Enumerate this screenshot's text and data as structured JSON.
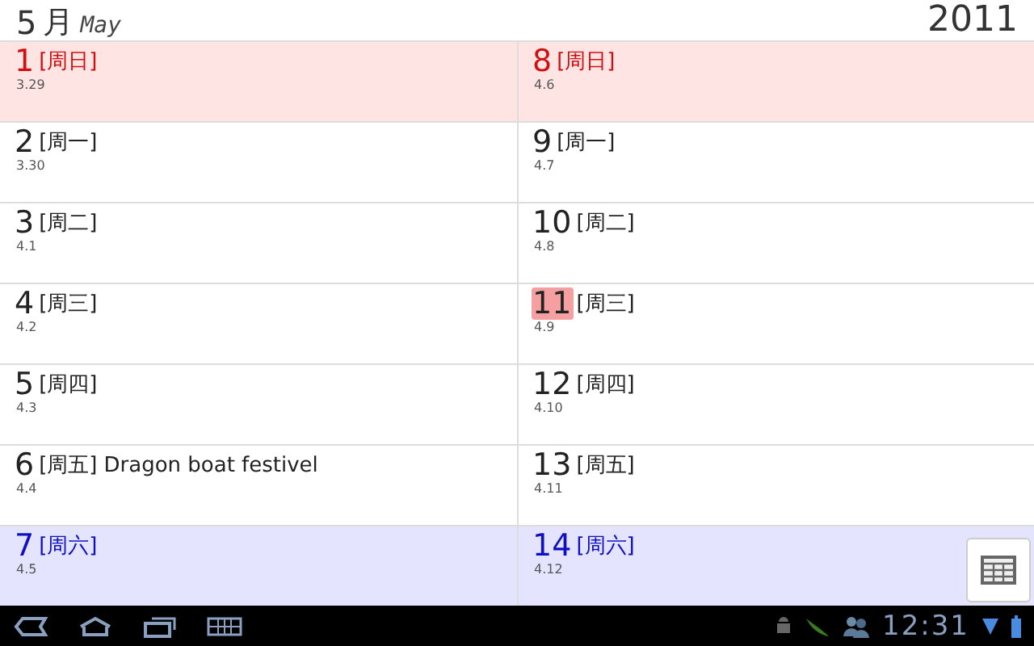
{
  "header": {
    "month_number": "5",
    "month_cn": "月",
    "month_en": "May",
    "year": "2011"
  },
  "columns": [
    {
      "days": [
        {
          "day": "1",
          "weekday": "[周日]",
          "lunar": "3.29",
          "kind": "sunday",
          "selected": false
        },
        {
          "day": "2",
          "weekday": "[周一]",
          "lunar": "3.30",
          "kind": "weekday",
          "selected": false
        },
        {
          "day": "3",
          "weekday": "[周二]",
          "lunar": "4.1",
          "kind": "weekday",
          "selected": false
        },
        {
          "day": "4",
          "weekday": "[周三]",
          "lunar": "4.2",
          "kind": "weekday",
          "selected": false
        },
        {
          "day": "5",
          "weekday": "[周四]",
          "lunar": "4.3",
          "kind": "weekday",
          "selected": false
        },
        {
          "day": "6",
          "weekday": "[周五]",
          "lunar": "4.4",
          "kind": "weekday",
          "selected": false,
          "event": "Dragon boat festivel"
        },
        {
          "day": "7",
          "weekday": "[周六]",
          "lunar": "4.5",
          "kind": "saturday",
          "selected": false
        }
      ]
    },
    {
      "days": [
        {
          "day": "8",
          "weekday": "[周日]",
          "lunar": "4.6",
          "kind": "sunday",
          "selected": false
        },
        {
          "day": "9",
          "weekday": "[周一]",
          "lunar": "4.7",
          "kind": "weekday",
          "selected": false
        },
        {
          "day": "10",
          "weekday": "[周二]",
          "lunar": "4.8",
          "kind": "weekday",
          "selected": false
        },
        {
          "day": "11",
          "weekday": "[周三]",
          "lunar": "4.9",
          "kind": "weekday",
          "selected": true
        },
        {
          "day": "12",
          "weekday": "[周四]",
          "lunar": "4.10",
          "kind": "weekday",
          "selected": false
        },
        {
          "day": "13",
          "weekday": "[周五]",
          "lunar": "4.11",
          "kind": "weekday",
          "selected": false
        },
        {
          "day": "14",
          "weekday": "[周六]",
          "lunar": "4.12",
          "kind": "saturday",
          "selected": false
        }
      ]
    }
  ],
  "status_bar": {
    "time": "12:31"
  }
}
